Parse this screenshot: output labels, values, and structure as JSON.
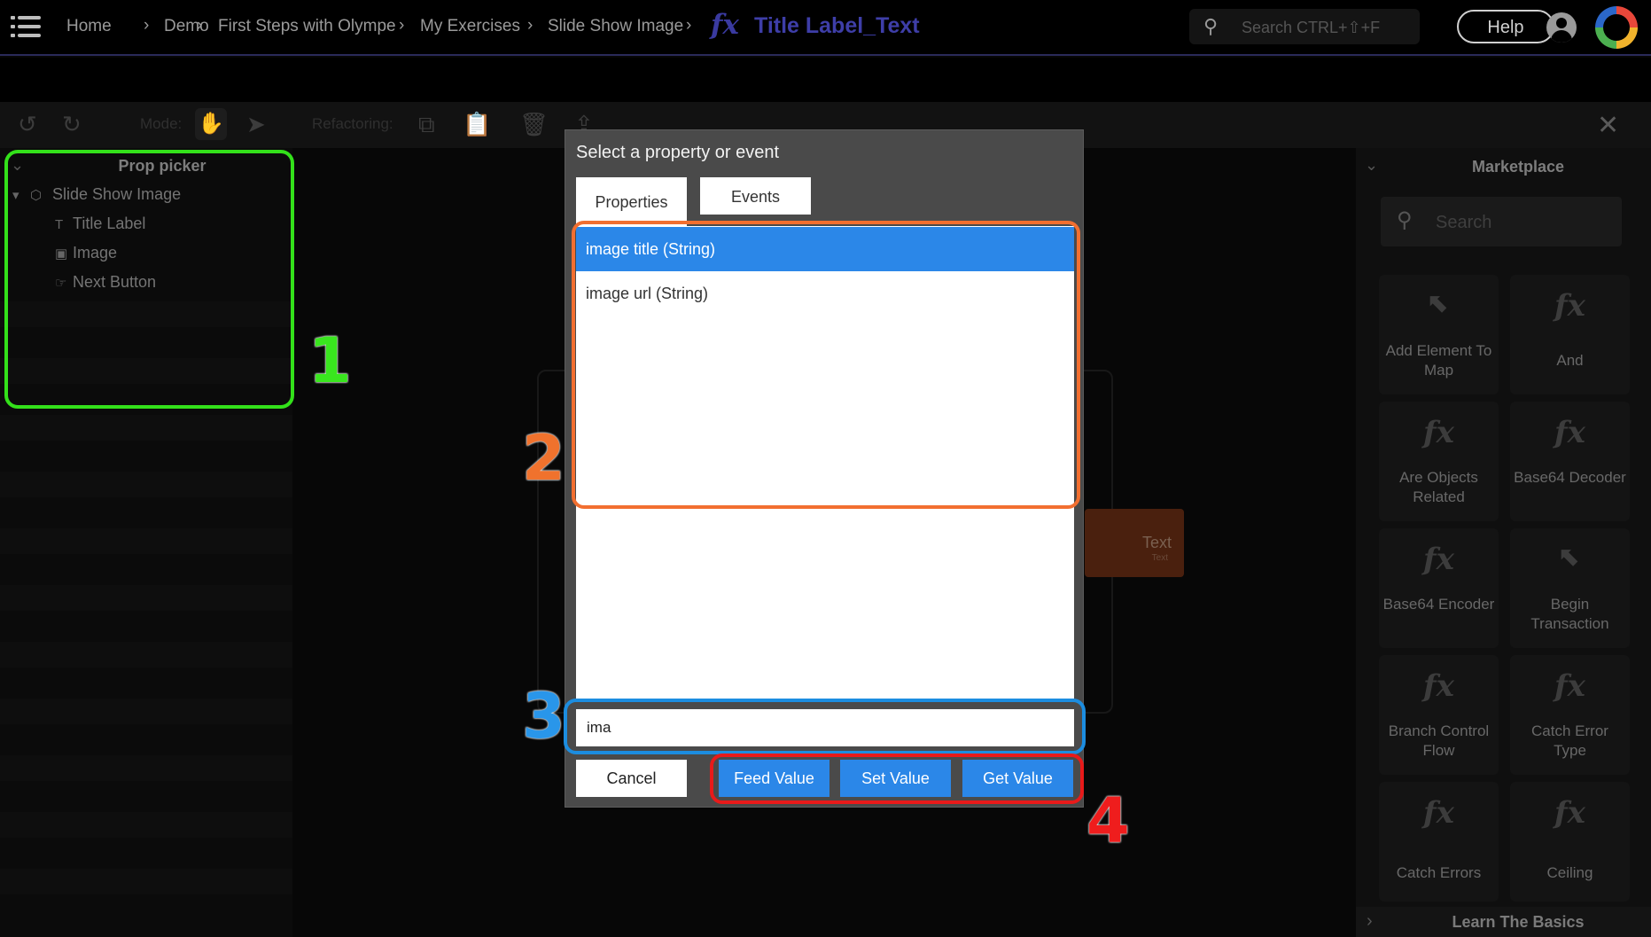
{
  "header": {
    "breadcrumbs": [
      "Home",
      "Demo",
      "First Steps with Olympe",
      "My Exercises",
      "Slide Show Image"
    ],
    "title": "Title Label_Text",
    "search_placeholder": "Search CTRL+⇧+F",
    "help_label": "Help"
  },
  "toolbar": {
    "mode_label": "Mode:",
    "refactoring_label": "Refactoring:"
  },
  "prop_picker": {
    "title": "Prop picker",
    "root": "Slide Show Image",
    "children": [
      "Title Label",
      "Image",
      "Next Button"
    ]
  },
  "dialog": {
    "title": "Select a property or event",
    "tabs": [
      "Properties",
      "Events"
    ],
    "items": [
      "image title (String)",
      "image url (String)"
    ],
    "filter_value": "ima",
    "cancel": "Cancel",
    "buttons": [
      "Feed Value",
      "Set Value",
      "Get Value"
    ]
  },
  "annotations": [
    "1",
    "2",
    "3",
    "4"
  ],
  "canvas": {
    "node_label": "Text",
    "node_sub": "Text"
  },
  "marketplace": {
    "title": "Marketplace",
    "search_placeholder": "Search",
    "tiles": [
      "Add Element To Map",
      "And",
      "Are Objects Related",
      "Base64 Decoder",
      "Base64 Encoder",
      "Begin Transaction",
      "Branch Control Flow",
      "Catch Error Type",
      "Catch Errors",
      "Ceiling"
    ],
    "learn": "Learn The Basics"
  },
  "colors": {
    "selected": "#2b87e8",
    "annotation_1": "#33e11a",
    "annotation_2": "#f26f30",
    "annotation_3": "#1c8de0",
    "annotation_4": "#e81a1a"
  }
}
